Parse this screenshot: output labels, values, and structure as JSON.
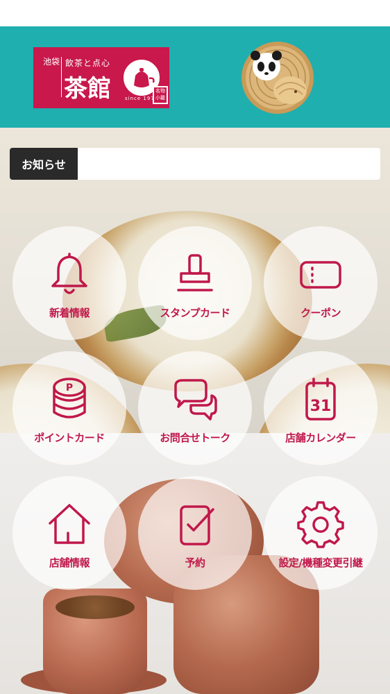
{
  "header": {
    "logo": {
      "side_text": "池袋",
      "top_text": "飲茶と点心",
      "main_text": "茶館",
      "since": "since 1979",
      "stamp": "名物小籠"
    },
    "mascot_icon": "panda-steamer-mascot-icon",
    "background_color": "#1fafae"
  },
  "notice": {
    "label": "お知らせ",
    "content": ""
  },
  "menu": {
    "accent_color": "#c0184a",
    "items": [
      {
        "label": "新着情報",
        "icon": "bell-icon"
      },
      {
        "label": "スタンプカード",
        "icon": "stamp-icon"
      },
      {
        "label": "クーポン",
        "icon": "ticket-icon"
      },
      {
        "label": "ポイントカード",
        "icon": "coin-stack-icon"
      },
      {
        "label": "お問合せトーク",
        "icon": "chat-bubbles-icon"
      },
      {
        "label": "店舗カレンダー",
        "icon": "calendar-icon",
        "day": "31"
      },
      {
        "label": "店舗情報",
        "icon": "house-icon"
      },
      {
        "label": "予約",
        "icon": "reservation-check-icon"
      },
      {
        "label": "設定/機種変更引継",
        "icon": "gear-icon"
      }
    ]
  }
}
